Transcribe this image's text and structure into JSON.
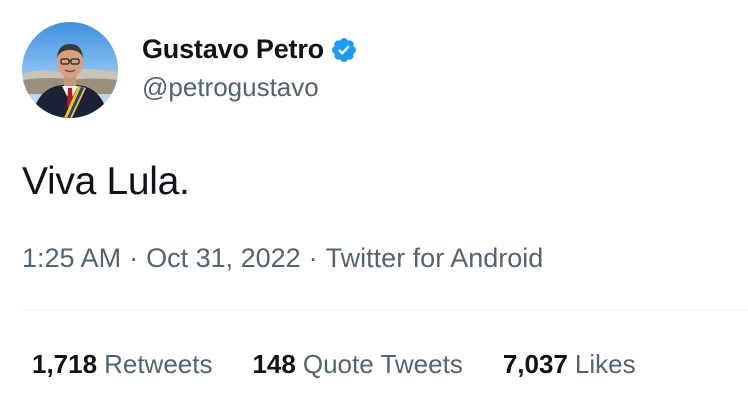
{
  "author": {
    "display_name": "Gustavo Petro",
    "handle": "@petrogustavo",
    "verified": true,
    "avatar_icon": "avatar-photo"
  },
  "tweet": {
    "text": "Viva Lula.",
    "time": "1:25 AM",
    "date": "Oct 31, 2022",
    "source": "Twitter for Android",
    "separator": "·"
  },
  "stats": {
    "retweets_count": "1,718",
    "retweets_label": "Retweets",
    "quotes_count": "148",
    "quotes_label": "Quote Tweets",
    "likes_count": "7,037",
    "likes_label": "Likes"
  },
  "colors": {
    "text_primary": "#0f1419",
    "text_secondary": "#536471",
    "verified_blue": "#1d9bf0",
    "divider": "#eff3f4"
  }
}
